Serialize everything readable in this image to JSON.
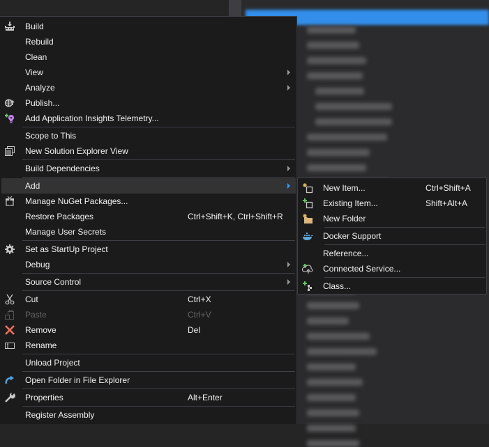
{
  "background": {
    "tree_rows": 28
  },
  "context_menu": {
    "items": [
      {
        "label": "Build",
        "icon": "build-icon",
        "shortcut": "",
        "submenu": false
      },
      {
        "label": "Rebuild",
        "icon": "",
        "shortcut": "",
        "submenu": false
      },
      {
        "label": "Clean",
        "icon": "",
        "shortcut": "",
        "submenu": false
      },
      {
        "label": "View",
        "icon": "",
        "shortcut": "",
        "submenu": true
      },
      {
        "label": "Analyze",
        "icon": "",
        "shortcut": "",
        "submenu": true
      },
      {
        "label": "Publish...",
        "icon": "publish-globe-icon",
        "shortcut": "",
        "submenu": false
      },
      {
        "label": "Add Application Insights Telemetry...",
        "icon": "application-insights-icon",
        "shortcut": "",
        "submenu": false
      },
      {
        "label": "Scope to This",
        "icon": "",
        "shortcut": "",
        "submenu": false
      },
      {
        "label": "New Solution Explorer View",
        "icon": "new-solution-explorer-view-icon",
        "shortcut": "",
        "submenu": false
      },
      {
        "label": "Build Dependencies",
        "icon": "",
        "shortcut": "",
        "submenu": true
      },
      {
        "label": "Add",
        "icon": "",
        "shortcut": "",
        "submenu": true,
        "highlighted": true
      },
      {
        "label": "Manage NuGet Packages...",
        "icon": "nuget-package-icon",
        "shortcut": "",
        "submenu": false
      },
      {
        "label": "Restore Packages",
        "icon": "",
        "shortcut": "Ctrl+Shift+K, Ctrl+Shift+R",
        "submenu": false
      },
      {
        "label": "Manage User Secrets",
        "icon": "",
        "shortcut": "",
        "submenu": false
      },
      {
        "label": "Set as StartUp Project",
        "icon": "gear-icon",
        "shortcut": "",
        "submenu": false
      },
      {
        "label": "Debug",
        "icon": "",
        "shortcut": "",
        "submenu": true
      },
      {
        "label": "Source Control",
        "icon": "",
        "shortcut": "",
        "submenu": true
      },
      {
        "label": "Cut",
        "icon": "scissors-icon",
        "shortcut": "Ctrl+X",
        "submenu": false
      },
      {
        "label": "Paste",
        "icon": "paste-icon",
        "shortcut": "Ctrl+V",
        "submenu": false,
        "disabled": true
      },
      {
        "label": "Remove",
        "icon": "remove-x-icon",
        "shortcut": "Del",
        "submenu": false
      },
      {
        "label": "Rename",
        "icon": "rename-icon",
        "shortcut": "",
        "submenu": false
      },
      {
        "label": "Unload Project",
        "icon": "",
        "shortcut": "",
        "submenu": false
      },
      {
        "label": "Open Folder in File Explorer",
        "icon": "open-folder-arrow-icon",
        "shortcut": "",
        "submenu": false
      },
      {
        "label": "Properties",
        "icon": "wrench-icon",
        "shortcut": "Alt+Enter",
        "submenu": false
      },
      {
        "label": "Register Assembly",
        "icon": "",
        "shortcut": "",
        "submenu": false
      }
    ]
  },
  "add_submenu": {
    "items": [
      {
        "label": "New Item...",
        "icon": "new-item-icon",
        "shortcut": "Ctrl+Shift+A"
      },
      {
        "label": "Existing Item...",
        "icon": "existing-item-icon",
        "shortcut": "Shift+Alt+A"
      },
      {
        "label": "New Folder",
        "icon": "new-folder-icon",
        "shortcut": ""
      },
      {
        "label": "Docker Support",
        "icon": "docker-whale-icon",
        "shortcut": ""
      },
      {
        "label": "Reference...",
        "icon": "",
        "shortcut": ""
      },
      {
        "label": "Connected Service...",
        "icon": "connected-service-icon",
        "shortcut": ""
      },
      {
        "label": "Class...",
        "icon": "add-class-icon",
        "shortcut": ""
      }
    ]
  },
  "colors": {
    "menu_bg": "#1b1b1c",
    "hover_bg": "#333334",
    "separator": "#3f3f46",
    "text": "#f1f1f1",
    "disabled_text": "#656565",
    "selection_blue": "#3399ff",
    "remove_red": "#f1705a",
    "insights_purple": "#c586f0",
    "open_folder_blue": "#4fa3e6"
  }
}
